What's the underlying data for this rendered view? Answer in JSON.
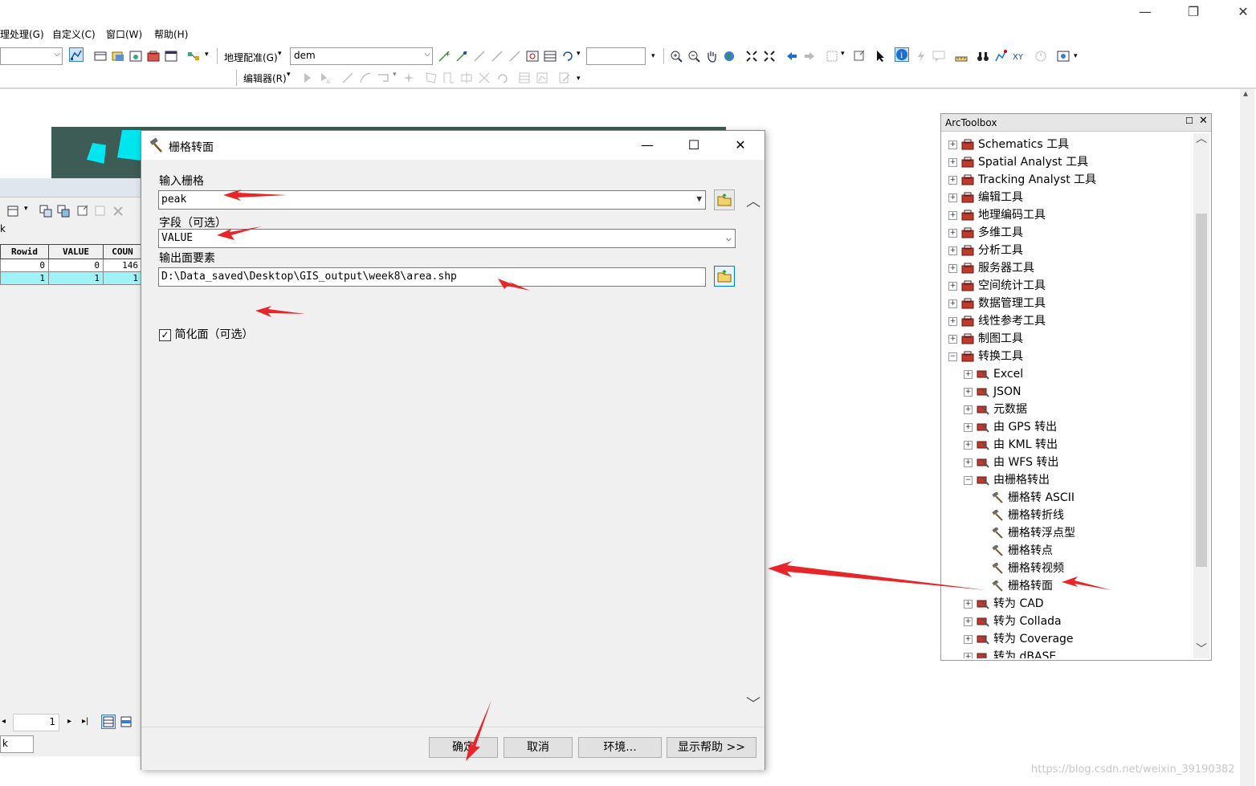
{
  "menubar": {
    "items": [
      "理处理(G)",
      "自定义(C)",
      "窗口(W)",
      "帮助(H)"
    ]
  },
  "toolbar": {
    "georef_label": "地理配准(G)",
    "layer_combo": "dem",
    "editor_label": "编辑器(R)"
  },
  "table": {
    "name_row": "k",
    "columns": [
      "Rowid",
      "VALUE",
      "COUN"
    ],
    "rows": [
      [
        "0",
        "0",
        "146"
      ],
      [
        "1",
        "1",
        "1"
      ]
    ],
    "page_value": "1",
    "tab_label": "k"
  },
  "dialog": {
    "title": "栅格转面",
    "input_raster_label": "输入栅格",
    "input_raster_value": "peak",
    "field_label": "字段（可选）",
    "field_value": "VALUE",
    "output_label": "输出面要素",
    "output_value": "D:\\Data_saved\\Desktop\\GIS_output\\week8\\area.shp",
    "simplify_label": "简化面（可选）",
    "simplify_checked": true,
    "ok": "确定",
    "cancel": "取消",
    "env": "环境...",
    "help": "显示帮助 >>"
  },
  "arctoolbox": {
    "title": "ArcToolbox",
    "items": [
      {
        "label": "Schematics 工具",
        "level": 0,
        "kind": "toolbox",
        "expanded": false
      },
      {
        "label": "Spatial Analyst 工具",
        "level": 0,
        "kind": "toolbox",
        "expanded": false
      },
      {
        "label": "Tracking Analyst 工具",
        "level": 0,
        "kind": "toolbox",
        "expanded": false
      },
      {
        "label": "编辑工具",
        "level": 0,
        "kind": "toolbox",
        "expanded": false
      },
      {
        "label": "地理编码工具",
        "level": 0,
        "kind": "toolbox",
        "expanded": false
      },
      {
        "label": "多维工具",
        "level": 0,
        "kind": "toolbox",
        "expanded": false
      },
      {
        "label": "分析工具",
        "level": 0,
        "kind": "toolbox",
        "expanded": false
      },
      {
        "label": "服务器工具",
        "level": 0,
        "kind": "toolbox",
        "expanded": false
      },
      {
        "label": "空间统计工具",
        "level": 0,
        "kind": "toolbox",
        "expanded": false
      },
      {
        "label": "数据管理工具",
        "level": 0,
        "kind": "toolbox",
        "expanded": false
      },
      {
        "label": "线性参考工具",
        "level": 0,
        "kind": "toolbox",
        "expanded": false
      },
      {
        "label": "制图工具",
        "level": 0,
        "kind": "toolbox",
        "expanded": false
      },
      {
        "label": "转换工具",
        "level": 0,
        "kind": "toolbox",
        "expanded": true
      },
      {
        "label": "Excel",
        "level": 1,
        "kind": "toolset",
        "expanded": false
      },
      {
        "label": "JSON",
        "level": 1,
        "kind": "toolset",
        "expanded": false
      },
      {
        "label": "元数据",
        "level": 1,
        "kind": "toolset",
        "expanded": false
      },
      {
        "label": "由 GPS 转出",
        "level": 1,
        "kind": "toolset",
        "expanded": false
      },
      {
        "label": "由 KML 转出",
        "level": 1,
        "kind": "toolset",
        "expanded": false
      },
      {
        "label": "由 WFS 转出",
        "level": 1,
        "kind": "toolset",
        "expanded": false
      },
      {
        "label": "由栅格转出",
        "level": 1,
        "kind": "toolset",
        "expanded": true
      },
      {
        "label": "栅格转 ASCII",
        "level": 2,
        "kind": "tool"
      },
      {
        "label": "栅格转折线",
        "level": 2,
        "kind": "tool"
      },
      {
        "label": "栅格转浮点型",
        "level": 2,
        "kind": "tool"
      },
      {
        "label": "栅格转点",
        "level": 2,
        "kind": "tool"
      },
      {
        "label": "栅格转视频",
        "level": 2,
        "kind": "tool"
      },
      {
        "label": "栅格转面",
        "level": 2,
        "kind": "tool"
      },
      {
        "label": "转为 CAD",
        "level": 1,
        "kind": "toolset",
        "expanded": false
      },
      {
        "label": "转为 Collada",
        "level": 1,
        "kind": "toolset",
        "expanded": false
      },
      {
        "label": "转为 Coverage",
        "level": 1,
        "kind": "toolset",
        "expanded": false
      },
      {
        "label": "转为 dBASE",
        "level": 1,
        "kind": "toolset",
        "expanded": false
      }
    ]
  },
  "watermark": "https://blog.csdn.net/weixin_39190382",
  "colors": {
    "arrow": "#e8262a",
    "selection": "#9ff3f6",
    "map_bg": "#3d5c55",
    "map_cyan": "#00e5ee",
    "toolbox_red": "#c0392b"
  }
}
